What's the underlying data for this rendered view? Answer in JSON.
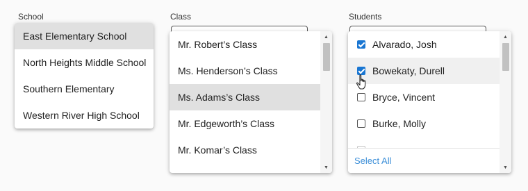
{
  "school": {
    "label": "School",
    "options": [
      {
        "label": "East Elementary School",
        "selected": true
      },
      {
        "label": "North Heights Middle School",
        "selected": false
      },
      {
        "label": "Southern Elementary",
        "selected": false
      },
      {
        "label": "Western River High School",
        "selected": false
      }
    ]
  },
  "class": {
    "label": "Class",
    "options": [
      {
        "label": "Mr. Robert’s Class",
        "selected": false
      },
      {
        "label": "Ms. Henderson’s Class",
        "selected": false
      },
      {
        "label": "Ms. Adams’s Class",
        "selected": true
      },
      {
        "label": "Mr. Edgeworth’s Class",
        "selected": false
      },
      {
        "label": "Mr. Komar’s Class",
        "selected": false
      }
    ]
  },
  "students": {
    "label": "Students",
    "options": [
      {
        "label": "Alvarado, Josh",
        "checked": true
      },
      {
        "label": "Bowekaty, Durell",
        "checked": true
      },
      {
        "label": "Bryce, Vincent",
        "checked": false
      },
      {
        "label": "Burke, Molly",
        "checked": false
      }
    ],
    "select_all": "Select All"
  },
  "colors": {
    "accent": "#1976d2",
    "link": "#3d8fd8",
    "selected_bg": "#e0e0e0"
  },
  "icons": {
    "scroll_up": "triangle-up",
    "scroll_down": "triangle-down",
    "cursor": "hand-pointer"
  }
}
